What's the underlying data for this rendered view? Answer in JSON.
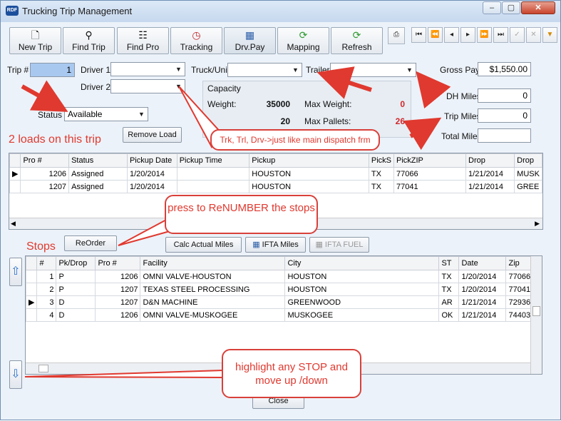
{
  "window": {
    "title": "Trucking Trip Management",
    "app_icon_text": "RDF"
  },
  "toolbar": {
    "buttons": [
      {
        "label": "New Trip",
        "icon": "document-icon"
      },
      {
        "label": "Find Trip",
        "icon": "binoculars-icon"
      },
      {
        "label": "Find Pro",
        "icon": "tree-icon"
      },
      {
        "label": "Tracking",
        "icon": "clock-icon"
      },
      {
        "label": "Drv.Pay",
        "icon": "calculator-icon"
      },
      {
        "label": "Mapping",
        "icon": "refresh-green-icon"
      },
      {
        "label": "Refresh",
        "icon": "refresh-green-icon"
      }
    ]
  },
  "form": {
    "trip_label": "Trip #",
    "trip_value": "1",
    "driver1_label": "Driver 1",
    "driver2_label": "Driver 2",
    "truck_label": "Truck/Unit",
    "trailer_label": "Trailer",
    "status_label": "Status",
    "status_value": "Available",
    "remove_load": "Remove Load",
    "gross_pay_label": "Gross Pay",
    "gross_pay_value": "$1,550.00",
    "dh_miles_label": "DH Miles",
    "dh_miles_value": "0",
    "trip_miles_label": "Trip Miles",
    "trip_miles_value": "0",
    "total_miles_label": "Total Miles",
    "total_miles_value": ""
  },
  "capacity": {
    "title": "Capacity",
    "weight_label": "Weight:",
    "weight_value": "35000",
    "max_weight_label": "Max Weight:",
    "max_weight_value": "0",
    "pallets_value": "20",
    "max_pallets_label": "Max Pallets:",
    "max_pallets_value": "26"
  },
  "loads": {
    "caption": "2 loads on this trip",
    "headers": [
      "Pro #",
      "Status",
      "Pickup Date",
      "Pickup Time",
      "Pickup",
      "PickS",
      "PickZIP",
      "Drop",
      "Drop"
    ],
    "rows": [
      {
        "pro": "1206",
        "status": "Assigned",
        "date": "1/20/2014",
        "time": "",
        "pickup": "HOUSTON",
        "st": "TX",
        "zip": "77066",
        "drop": "1/21/2014",
        "drop2": "MUSK"
      },
      {
        "pro": "1207",
        "status": "Assigned",
        "date": "1/20/2014",
        "time": "",
        "pickup": "HOUSTON",
        "st": "TX",
        "zip": "77041",
        "drop": "1/21/2014",
        "drop2": "GREE"
      }
    ]
  },
  "stops": {
    "caption": "Stops",
    "reorder": "ReOrder",
    "calc_actual": "Calc Actual Miles",
    "ifta_miles": "IFTA Miles",
    "ifta_fuel": "IFTA FUEL",
    "headers": [
      "#",
      "Pk/Drop",
      "Pro #",
      "Facility",
      "City",
      "ST",
      "Date",
      "Zip"
    ],
    "rows": [
      {
        "n": "1",
        "pk": "P",
        "pro": "1206",
        "facility": "OMNI VALVE-HOUSTON",
        "city": "HOUSTON",
        "st": "TX",
        "date": "1/20/2014",
        "zip": "77066"
      },
      {
        "n": "2",
        "pk": "P",
        "pro": "1207",
        "facility": "TEXAS STEEL PROCESSING",
        "city": "HOUSTON",
        "st": "TX",
        "date": "1/20/2014",
        "zip": "77041"
      },
      {
        "n": "3",
        "pk": "D",
        "pro": "1207",
        "facility": "D&N MACHINE",
        "city": "GREENWOOD",
        "st": "AR",
        "date": "1/21/2014",
        "zip": "72936"
      },
      {
        "n": "4",
        "pk": "D",
        "pro": "1206",
        "facility": "OMNI VALVE-MUSKOGEE",
        "city": "MUSKOGEE",
        "st": "OK",
        "date": "1/21/2014",
        "zip": "74403"
      }
    ]
  },
  "close_label": "Close",
  "annotations": {
    "drivers": "Trk, Trl, Drv->just like main dispatch frm",
    "renumber": "press to ReNUMBER the stops",
    "highlight": "highlight any STOP and move up /down"
  }
}
